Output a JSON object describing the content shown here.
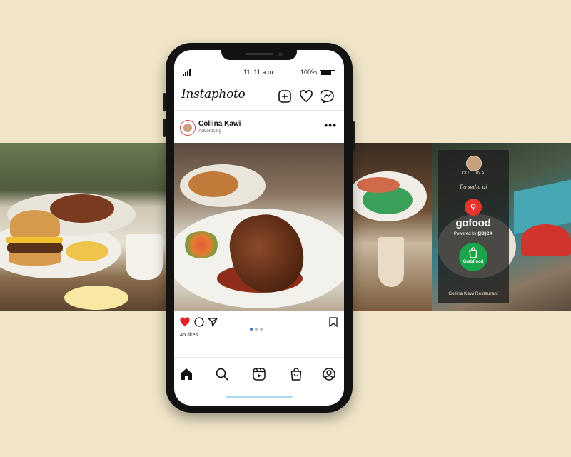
{
  "status_bar": {
    "time": "11: 11 a.m.",
    "battery": "100%"
  },
  "app": {
    "brand": "Instaphoto"
  },
  "top_icons": [
    "new-post-icon",
    "heart-icon",
    "messenger-icon"
  ],
  "post": {
    "account_name": "Collina Kawi",
    "sponsored_label": "Advertising",
    "likes": "45 likes",
    "carousel_total": 3,
    "carousel_active": 1
  },
  "bottom_nav": [
    "home-icon",
    "search-icon",
    "reels-icon",
    "shop-icon",
    "profile-icon"
  ],
  "promo": {
    "logo_text": "COLLINA",
    "available_text": "Tersedia di",
    "gofood": "gofood",
    "gojek_prefix": "Powered by",
    "gojek": "gojek",
    "grab": "GrabFood",
    "footer": "Collina Kawi Restaurant"
  },
  "colors": {
    "background": "#f0e5c9",
    "like_red": "#e0242a",
    "dot_active": "#2f7ad8",
    "gofood_red": "#e8342c",
    "grab_green": "#19a64b"
  }
}
